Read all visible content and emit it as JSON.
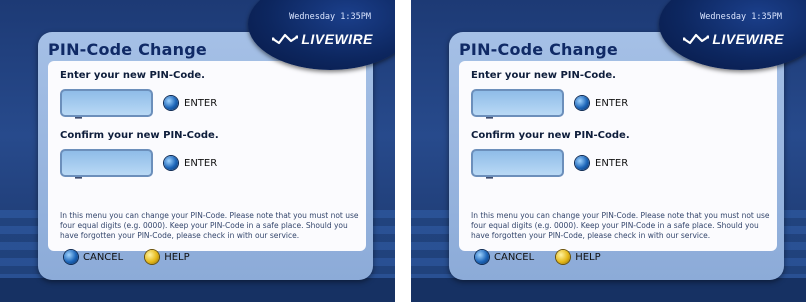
{
  "screens": [
    {
      "datetime": "Wednesday 1:35PM",
      "brand": "LIVEWIRE",
      "title": "PIN-Code Change",
      "new_pin_label": "Enter your new PIN-Code.",
      "confirm_pin_label": "Confirm your new PIN-Code.",
      "new_pin_value": "_",
      "confirm_pin_value": "_",
      "enter_label": "ENTER",
      "info_text": "In this menu you can change your PIN-Code.  Please note that you must not use four equal digits (e.g. 0000).  Keep your PIN-Code in a safe place.  Should you have forgotten your PIN-Code, please check in with our service.",
      "cancel_label": "CANCEL",
      "help_label": "HELP"
    },
    {
      "datetime": "Wednesday 1:35PM",
      "brand": "LIVEWIRE",
      "title": "PIN-Code Change",
      "new_pin_label": "Enter your new PIN-Code.",
      "confirm_pin_label": "Confirm your new PIN-Code.",
      "new_pin_value": "_",
      "confirm_pin_value": "_",
      "enter_label": "ENTER",
      "info_text": "In this menu you can change your PIN-Code.  Please note that you must not use four equal digits (e.g. 0000).  Keep your PIN-Code in a safe place.  Should you have forgotten your PIN-Code, please check in with our service.",
      "cancel_label": "CANCEL",
      "help_label": "HELP"
    }
  ],
  "colors": {
    "background": "#274a8c",
    "panel": "#a5c0e6",
    "title": "#102a66",
    "button_blue": "#1c65b8",
    "button_yellow": "#e5b818"
  },
  "icons": [
    "livewire-logo-icon",
    "remote-blue-button-icon",
    "remote-yellow-button-icon"
  ]
}
